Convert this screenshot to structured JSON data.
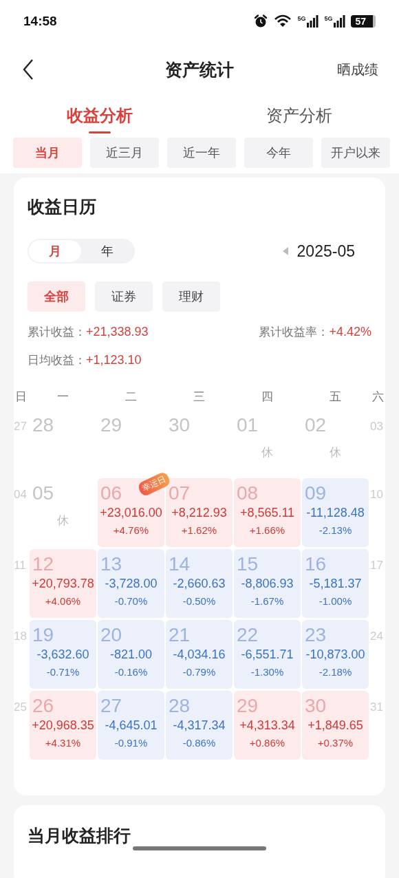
{
  "status_bar": {
    "time": "14:58",
    "networks": [
      "5G",
      "5G"
    ],
    "battery": "57"
  },
  "header": {
    "title": "资产统计",
    "action": "晒成绩"
  },
  "tabs": [
    {
      "label": "收益分析",
      "selected": true
    },
    {
      "label": "资产分析",
      "selected": false
    }
  ],
  "periods": [
    {
      "label": "当月",
      "selected": true
    },
    {
      "label": "近三月",
      "selected": false
    },
    {
      "label": "近一年",
      "selected": false
    },
    {
      "label": "今年",
      "selected": false
    },
    {
      "label": "开户以来",
      "selected": false
    }
  ],
  "calendar_card": {
    "title": "收益日历",
    "modes": [
      {
        "label": "月",
        "selected": true
      },
      {
        "label": "年",
        "selected": false
      }
    ],
    "month": "2025-05",
    "filters": [
      {
        "label": "全部",
        "selected": true
      },
      {
        "label": "证券",
        "selected": false
      },
      {
        "label": "理财",
        "selected": false
      }
    ],
    "summary": [
      {
        "label": "累计收益：",
        "value": "+21,338.93"
      },
      {
        "label": "累计收益率：",
        "value": "+4.42%"
      },
      {
        "label": "日均收益：",
        "value": "+1,123.10"
      }
    ],
    "weekdays": [
      "日",
      "一",
      "二",
      "三",
      "四",
      "五",
      "六"
    ],
    "weeks": [
      {
        "sun": "27",
        "sat": "03",
        "days": [
          {
            "day": "28",
            "kind": "none"
          },
          {
            "day": "29",
            "kind": "none"
          },
          {
            "day": "30",
            "kind": "none"
          },
          {
            "day": "01",
            "kind": "none",
            "rest": "休"
          },
          {
            "day": "02",
            "kind": "none",
            "rest": "休"
          }
        ]
      },
      {
        "sun": "04",
        "sat": "10",
        "days": [
          {
            "day": "05",
            "kind": "none",
            "rest": "休"
          },
          {
            "day": "06",
            "kind": "gain",
            "amount": "+23,016.00",
            "pct": "+4.76%",
            "badge": "幸运日"
          },
          {
            "day": "07",
            "kind": "gain",
            "amount": "+8,212.93",
            "pct": "+1.62%"
          },
          {
            "day": "08",
            "kind": "gain",
            "amount": "+8,565.11",
            "pct": "+1.66%"
          },
          {
            "day": "09",
            "kind": "loss",
            "amount": "-11,128.48",
            "pct": "-2.13%"
          }
        ]
      },
      {
        "sun": "11",
        "sat": "17",
        "days": [
          {
            "day": "12",
            "kind": "gain",
            "amount": "+20,793.78",
            "pct": "+4.06%"
          },
          {
            "day": "13",
            "kind": "loss",
            "amount": "-3,728.00",
            "pct": "-0.70%"
          },
          {
            "day": "14",
            "kind": "loss",
            "amount": "-2,660.63",
            "pct": "-0.50%"
          },
          {
            "day": "15",
            "kind": "loss",
            "amount": "-8,806.93",
            "pct": "-1.67%"
          },
          {
            "day": "16",
            "kind": "loss",
            "amount": "-5,181.37",
            "pct": "-1.00%"
          }
        ]
      },
      {
        "sun": "18",
        "sat": "24",
        "days": [
          {
            "day": "19",
            "kind": "loss",
            "amount": "-3,632.60",
            "pct": "-0.71%"
          },
          {
            "day": "20",
            "kind": "loss",
            "amount": "-821.00",
            "pct": "-0.16%"
          },
          {
            "day": "21",
            "kind": "loss",
            "amount": "-4,034.16",
            "pct": "-0.79%"
          },
          {
            "day": "22",
            "kind": "loss",
            "amount": "-6,551.71",
            "pct": "-1.30%"
          },
          {
            "day": "23",
            "kind": "loss",
            "amount": "-10,873.00",
            "pct": "-2.18%"
          }
        ]
      },
      {
        "sun": "25",
        "sat": "31",
        "days": [
          {
            "day": "26",
            "kind": "gain",
            "amount": "+20,968.35",
            "pct": "+4.31%"
          },
          {
            "day": "27",
            "kind": "loss",
            "amount": "-4,645.01",
            "pct": "-0.91%"
          },
          {
            "day": "28",
            "kind": "loss",
            "amount": "-4,317.34",
            "pct": "-0.86%"
          },
          {
            "day": "29",
            "kind": "gain",
            "amount": "+4,313.34",
            "pct": "+0.86%"
          },
          {
            "day": "30",
            "kind": "gain",
            "amount": "+1,849.65",
            "pct": "+0.37%"
          }
        ]
      }
    ]
  },
  "ranking_card": {
    "title": "当月收益排行"
  }
}
